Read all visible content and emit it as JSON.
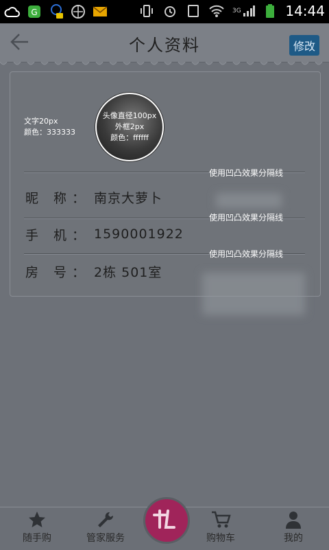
{
  "status_bar": {
    "time": "14:44",
    "network": "3G"
  },
  "header": {
    "title": "个人资料",
    "edit_label": "修改"
  },
  "profile": {
    "avatar_note": [
      "头像直径100px",
      "外框2px",
      "颜色：ffffff"
    ],
    "text_note": [
      "文字20px",
      "颜色：333333"
    ],
    "divider_note": "使用凹凸效果分隔线",
    "fields": [
      {
        "label": "昵 称：",
        "value": "南京大萝卜"
      },
      {
        "label": "手 机：",
        "value": "1590001922"
      },
      {
        "label": "房 号：",
        "value": "2栋 501室"
      }
    ]
  },
  "tabs": [
    {
      "label": "随手购",
      "icon": "star-icon"
    },
    {
      "label": "管家服务",
      "icon": "wrench-icon"
    },
    {
      "label": "购物车",
      "icon": "cart-icon"
    },
    {
      "label": "我的",
      "icon": "user-icon"
    }
  ],
  "colors": {
    "accent": "#a0245a",
    "edit_button": "#1e5a86"
  }
}
